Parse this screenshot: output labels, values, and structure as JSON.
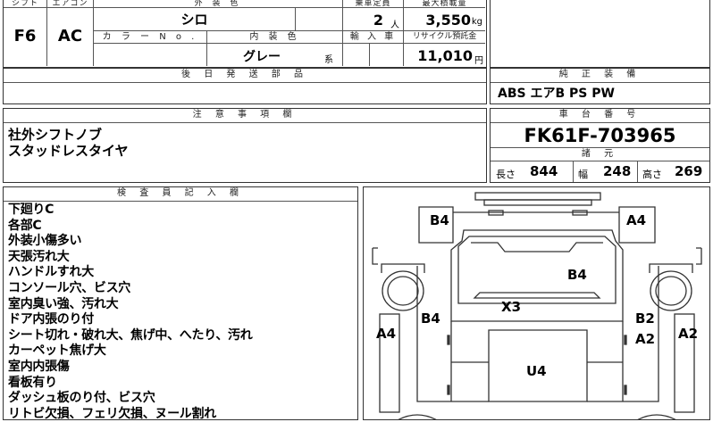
{
  "top_table": {
    "headers": [
      "シフト",
      "エアコン",
      "外 装 色",
      "乗車定員",
      "最大積載量"
    ],
    "shift": "F6",
    "aircon": "AC",
    "exterior_color": "シロ",
    "capacity": "2",
    "capacity_unit": "人",
    "max_load": "3,550",
    "max_load_unit": "kg",
    "row2_labels": [
      "カ ラ ー N o .",
      "内 装 色",
      "輸 入 車",
      "リサイクル預託金"
    ],
    "color_no": "",
    "interior_color": "グレー",
    "interior_suffix": "系",
    "import": "",
    "recycle_fee": "11,010",
    "recycle_unit": "円"
  },
  "later_parts": {
    "header": "後 日 発 送 部 品",
    "value": ""
  },
  "genuine_equipment": {
    "header": "純 正 装 備",
    "value": "ABS エアB PS PW"
  },
  "notes": {
    "header": "注 意 事 項 欄",
    "lines": [
      "社外シフトノブ",
      "スタッドレスタイヤ"
    ]
  },
  "chassis": {
    "header": "車 台 番 号",
    "number": "FK61F-703965",
    "dims_header": "諸 元",
    "length_label": "長さ",
    "length": "844",
    "width_label": "幅",
    "width": "248",
    "height_label": "高さ",
    "height": "269"
  },
  "inspector": {
    "header": "検 査 員 記 入 欄",
    "lines": [
      "下廻りC",
      "各部C",
      "外装小傷多い",
      "天張汚れ大",
      "ハンドルすれ大",
      "コンソール穴、ビス穴",
      "室内臭い強、汚れ大",
      "ドア内張のり付",
      "シート切れ・破れ大、焦げ中、へたり、汚れ",
      "カーペット焦げ大",
      "室内内張傷",
      "看板有り",
      "ダッシュ板のり付、ビス穴",
      "リトビ欠損、フェリ欠損、ヌール割れ"
    ]
  },
  "diagram_marks": {
    "left_front_corner": "B4",
    "right_front_corner": "A4",
    "hood": "B4",
    "windshield": "X3",
    "left_front_door": "B4",
    "left_side": "A4",
    "right_front_door": "B2",
    "right_front_door_2": "A2",
    "right_side": "A2",
    "cargo": "U4"
  }
}
